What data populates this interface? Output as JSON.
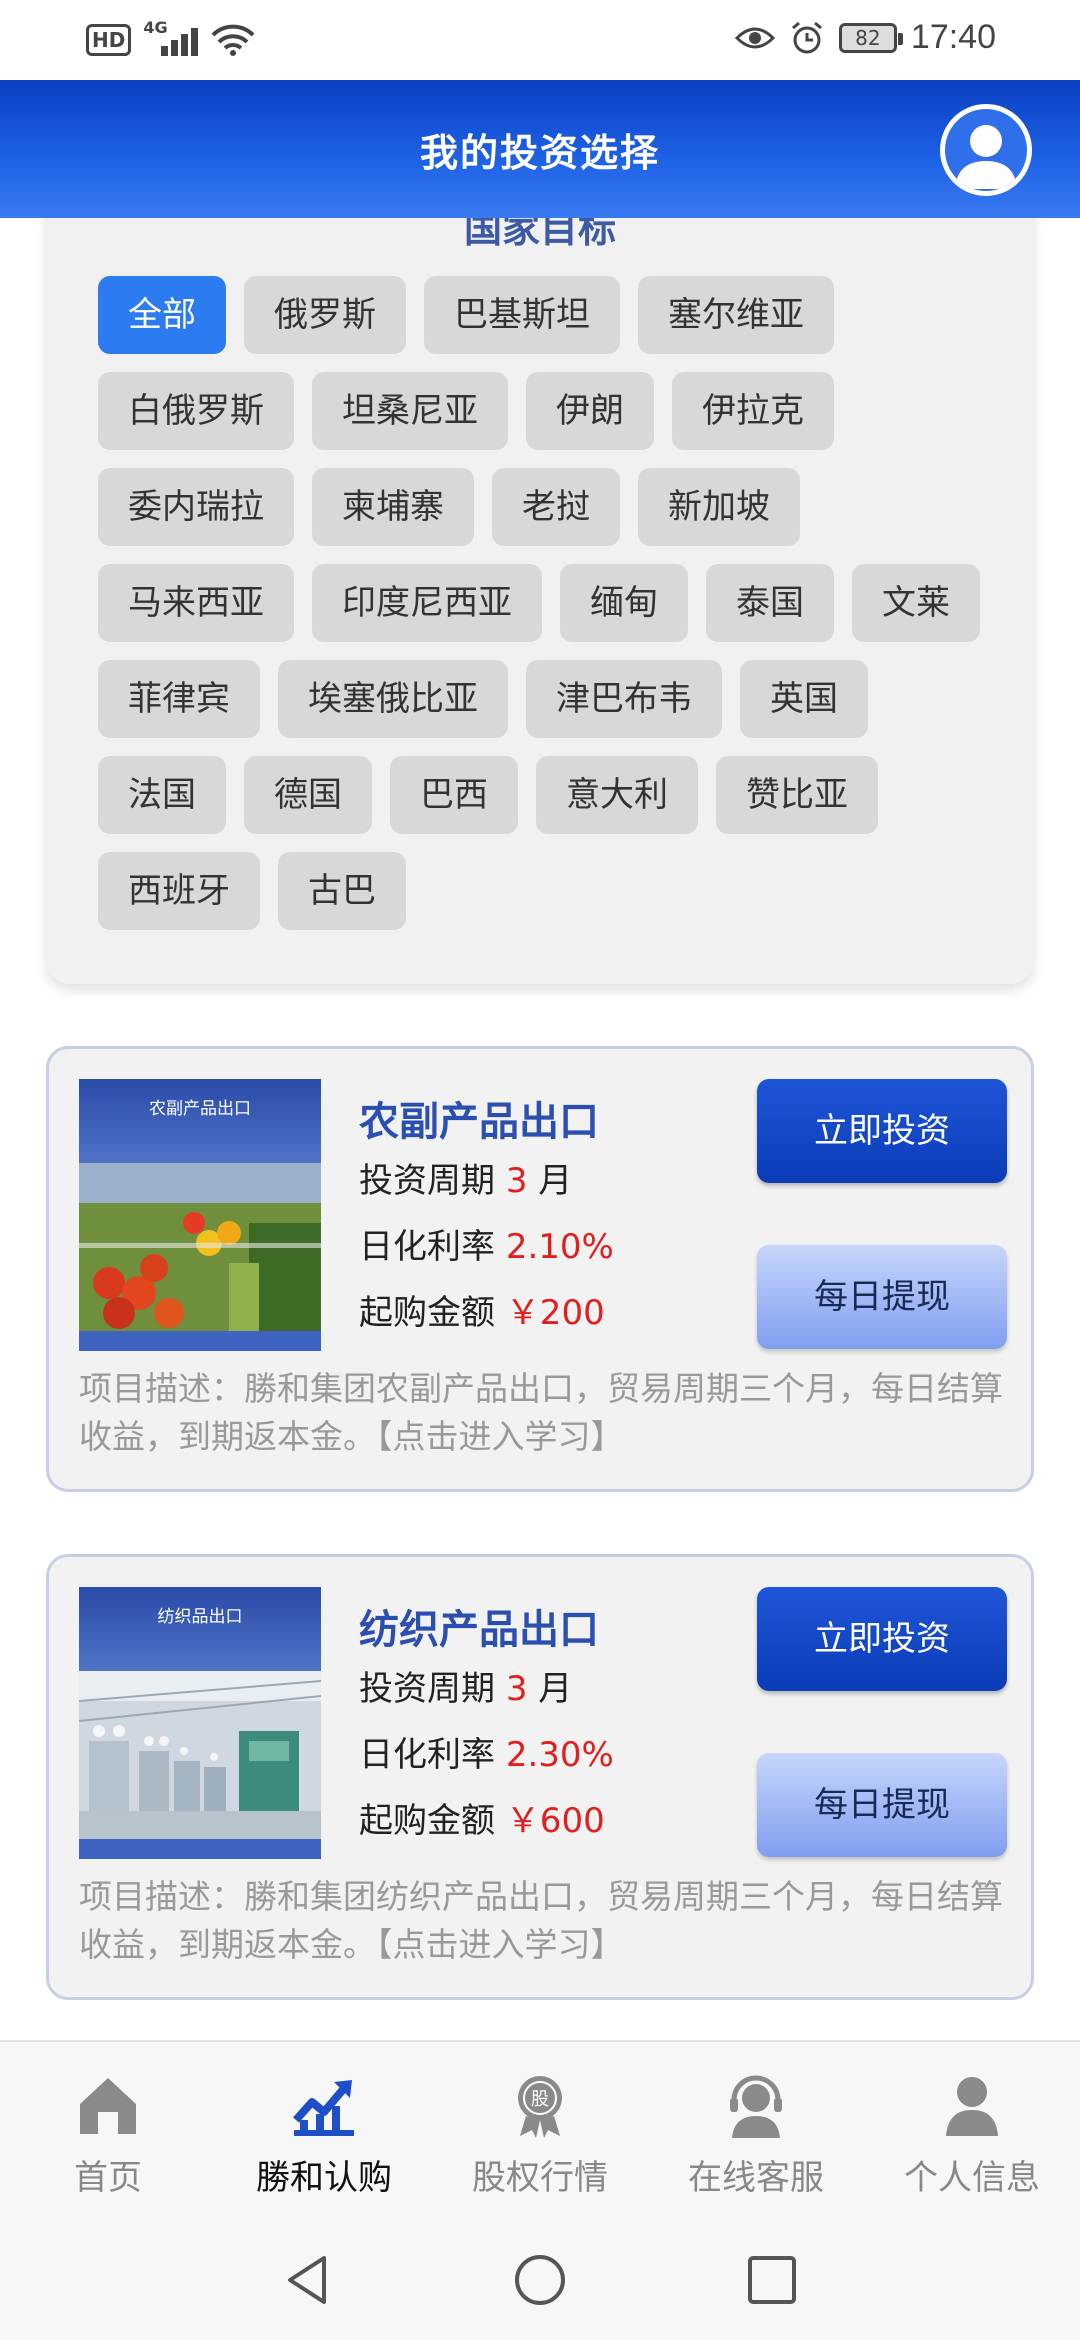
{
  "status_bar": {
    "hd": "HD",
    "network": "4G",
    "battery": "82",
    "time": "17:40"
  },
  "header": {
    "title": "我的投资选择",
    "avatar_icon": "user-avatar-icon"
  },
  "countries": {
    "heading": "国家目标",
    "items": [
      "全部",
      "俄罗斯",
      "巴基斯坦",
      "塞尔维亚",
      "白俄罗斯",
      "坦桑尼亚",
      "伊朗",
      "伊拉克",
      "委内瑞拉",
      "柬埔寨",
      "老挝",
      "新加坡",
      "马来西亚",
      "印度尼西亚",
      "缅甸",
      "泰国",
      "文莱",
      "菲律宾",
      "埃塞俄比亚",
      "津巴布韦",
      "英国",
      "法国",
      "德国",
      "巴西",
      "意大利",
      "赞比亚",
      "西班牙",
      "古巴"
    ],
    "selected": "全部"
  },
  "products": [
    {
      "image_caption": "农副产品出口",
      "name": "农副产品出口",
      "period_label": "投资周期",
      "period_value": "3",
      "period_unit": "月",
      "rate_label": "日化利率",
      "rate_value": "2.10%",
      "min_label": "起购金额",
      "min_value": "￥200",
      "invest_label": "立即投资",
      "withdraw_label": "每日提现",
      "description": "项目描述：勝和集团农副产品出口，贸易周期三个月，每日结算收益，到期返本金。【点击进入学习】"
    },
    {
      "image_caption": "纺织品出口",
      "name": "纺织产品出口",
      "period_label": "投资周期",
      "period_value": "3",
      "period_unit": "月",
      "rate_label": "日化利率",
      "rate_value": "2.30%",
      "min_label": "起购金额",
      "min_value": "￥600",
      "invest_label": "立即投资",
      "withdraw_label": "每日提现",
      "description": "项目描述：勝和集团纺织产品出口，贸易周期三个月，每日结算收益，到期返本金。【点击进入学习】"
    }
  ],
  "bottom_nav": {
    "items": [
      {
        "label": "首页",
        "icon": "home-icon"
      },
      {
        "label": "勝和认购",
        "icon": "trend-chart-icon"
      },
      {
        "label": "股权行情",
        "icon": "stock-badge-icon"
      },
      {
        "label": "在线客服",
        "icon": "headset-agent-icon"
      },
      {
        "label": "个人信息",
        "icon": "person-icon"
      }
    ],
    "active": "勝和认购"
  },
  "colors": {
    "brand_blue": "#0a3fc2",
    "accent_blue": "#2d7bf0",
    "value_red": "#e02020"
  }
}
